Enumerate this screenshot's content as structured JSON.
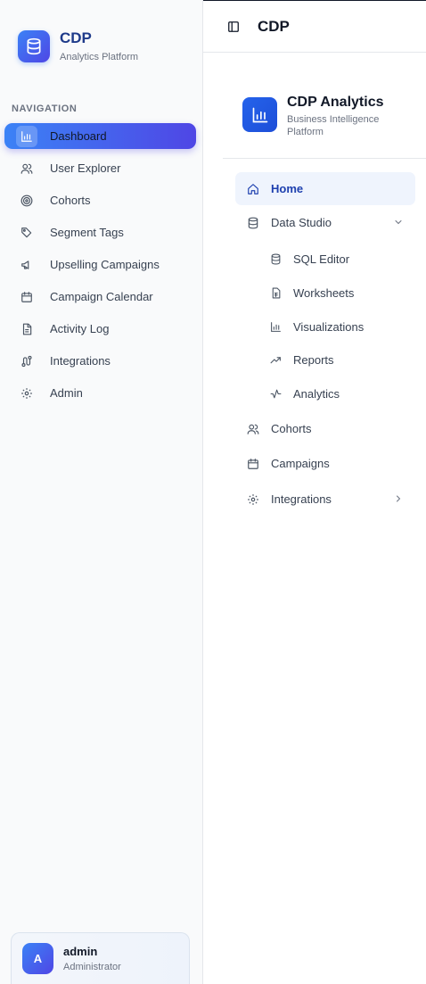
{
  "brand": {
    "title": "CDP",
    "subtitle": "Analytics Platform"
  },
  "nav": {
    "heading": "NAVIGATION",
    "items": [
      {
        "label": "Dashboard",
        "icon": "bar-chart-icon",
        "active": true
      },
      {
        "label": "User Explorer",
        "icon": "users-icon"
      },
      {
        "label": "Cohorts",
        "icon": "target-icon"
      },
      {
        "label": "Segment Tags",
        "icon": "tags-icon"
      },
      {
        "label": "Upselling Campaigns",
        "icon": "megaphone-icon"
      },
      {
        "label": "Campaign Calendar",
        "icon": "calendar-icon"
      },
      {
        "label": "Activity Log",
        "icon": "file-text-icon"
      },
      {
        "label": "Integrations",
        "icon": "route-icon"
      },
      {
        "label": "Admin",
        "icon": "gear-icon"
      }
    ]
  },
  "user": {
    "initial": "A",
    "name": "admin",
    "role": "Administrator"
  },
  "topbar": {
    "title": "CDP"
  },
  "panel": {
    "title": "CDP Analytics",
    "subtitle": "Business Intelligence Platform",
    "items": {
      "home": "Home",
      "data_studio": "Data Studio",
      "sub": [
        "SQL Editor",
        "Worksheets",
        "Visualizations",
        "Reports",
        "Analytics"
      ],
      "cohorts": "Cohorts",
      "campaigns": "Campaigns",
      "integrations": "Integrations"
    }
  },
  "colors": {
    "accent": "#4f46e5",
    "primary": "#3b82f6",
    "brand_text": "#1e3a8a"
  }
}
